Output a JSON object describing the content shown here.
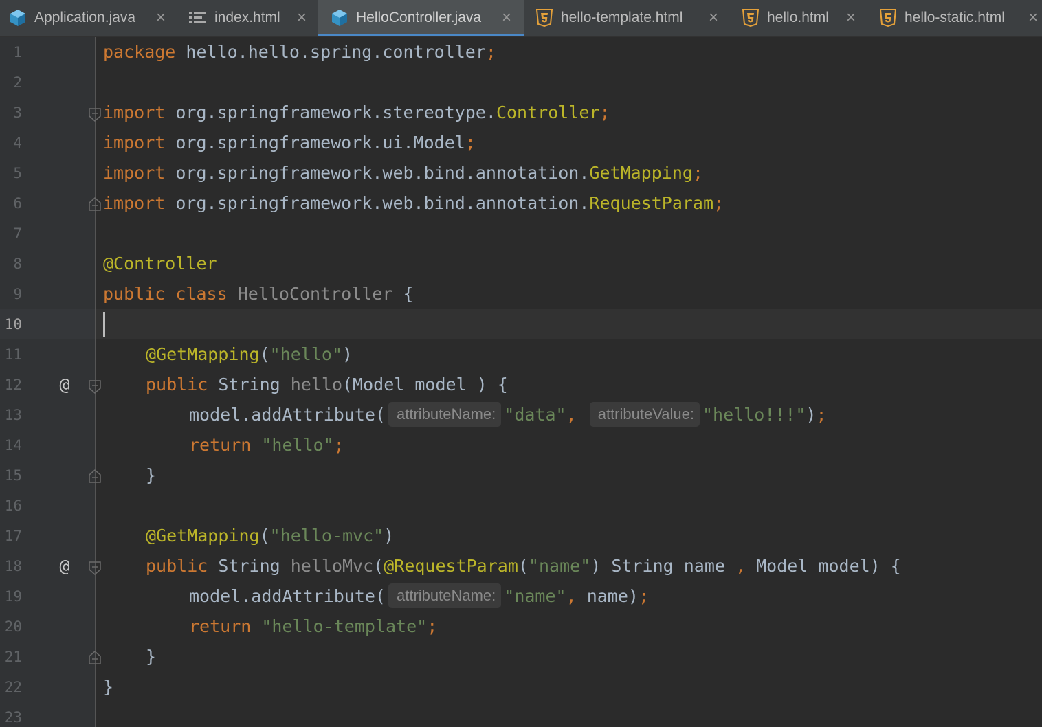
{
  "tabs": [
    {
      "label": "Application.java",
      "icon": "java-class-icon",
      "active": false
    },
    {
      "label": "index.html",
      "icon": "html-structure-icon",
      "active": false
    },
    {
      "label": "HelloController.java",
      "icon": "java-class-icon",
      "active": true
    },
    {
      "label": "hello-template.html",
      "icon": "html5-icon",
      "active": false
    },
    {
      "label": "hello.html",
      "icon": "html5-icon",
      "active": false
    },
    {
      "label": "hello-static.html",
      "icon": "html5-icon",
      "active": false
    }
  ],
  "tab_close_glyph": "×",
  "editor": {
    "current_line": 10,
    "line_numbers": [
      "1",
      "2",
      "3",
      "4",
      "5",
      "6",
      "7",
      "8",
      "9",
      "10",
      "11",
      "12",
      "13",
      "14",
      "15",
      "16",
      "17",
      "18",
      "19",
      "20",
      "21",
      "22",
      "23"
    ],
    "gutter_marker": "@",
    "code": {
      "l1": {
        "kw": "package",
        "rest": " hello.hello.spring.controller",
        "semi": ";"
      },
      "l3": {
        "kw": "import",
        "rest": " org.springframework.stereotype.",
        "cls": "Controller",
        "semi": ";"
      },
      "l4": {
        "kw": "import",
        "rest": " org.springframework.ui.Model",
        "semi": ";"
      },
      "l5": {
        "kw": "import",
        "rest": " org.springframework.web.bind.annotation.",
        "cls": "GetMapping",
        "semi": ";"
      },
      "l6": {
        "kw": "import",
        "rest": " org.springframework.web.bind.annotation.",
        "cls": "RequestParam",
        "semi": ";"
      },
      "l8": {
        "ann": "@Controller"
      },
      "l9": {
        "kw1": "public",
        "kw2": "class",
        "name": "HelloController",
        "brace": " {"
      },
      "l11": {
        "ann": "@GetMapping",
        "open": "(",
        "str": "\"hello\"",
        "close": ")"
      },
      "l12": {
        "kw": "public",
        "type": " String ",
        "method": "hello",
        "params": "(Model model ) {"
      },
      "l13": {
        "call": "model.addAttribute(",
        "hint1": "attributeName:",
        "str1": "\"data\"",
        "comma": ",",
        "hint2": "attributeValue:",
        "str2": "\"hello!!!\"",
        "close": ")",
        "semi": ";"
      },
      "l14": {
        "kw": "return",
        "str": "\"hello\"",
        "semi": ";"
      },
      "l15": {
        "brace": "}"
      },
      "l17": {
        "ann": "@GetMapping",
        "open": "(",
        "str": "\"hello-mvc\"",
        "close": ")"
      },
      "l18": {
        "kw": "public",
        "type": " String ",
        "method": "helloMvc",
        "open": "(",
        "ann": "@RequestParam",
        "aopen": "(",
        "str": "\"name\"",
        "aclose": ")",
        "mid": " String name ",
        "comma": ",",
        "tail": " Model model) {"
      },
      "l19": {
        "call": "model.addAttribute(",
        "hint1": "attributeName:",
        "str1": "\"name\"",
        "comma": ",",
        "rest": " name)",
        "semi": ";"
      },
      "l20": {
        "kw": "return",
        "str": "\"hello-template\"",
        "semi": ";"
      },
      "l21": {
        "brace": "}"
      },
      "l22": {
        "brace": "}"
      }
    }
  },
  "colors": {
    "keyword": "#cc7832",
    "annotation": "#bbb529",
    "string": "#6a8759",
    "default_text": "#a9b7c6",
    "unused_name": "#8c8c8c",
    "background": "#2b2b2b",
    "tab_underline": "#4a88c7"
  }
}
